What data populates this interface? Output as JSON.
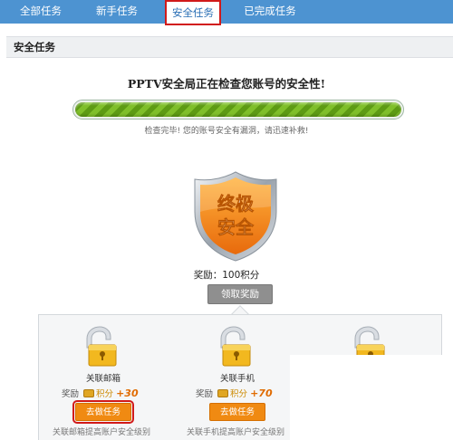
{
  "tabs": [
    {
      "label": "全部任务"
    },
    {
      "label": "新手任务"
    },
    {
      "label": "安全任务"
    },
    {
      "label": "已完成任务"
    }
  ],
  "section": {
    "title": "安全任务"
  },
  "scan": {
    "title": "PPTV安全局正在检查您账号的安全性!",
    "progress_percent": 100,
    "result": "检查完毕! 您的账号安全有漏洞，请迅速补救!"
  },
  "badge": {
    "line1": "终极",
    "line2": "安全"
  },
  "reward": {
    "text": "奖励：100积分",
    "claim_label": "领取奖励"
  },
  "tasks": [
    {
      "name": "关联邮箱",
      "reward_label": "奖励",
      "points_label": "积分",
      "points": "+30",
      "button": "去做任务",
      "desc": "关联邮箱提高账户安全级别"
    },
    {
      "name": "关联手机",
      "reward_label": "奖励",
      "points_label": "积分",
      "points": "+70",
      "button": "去做任务",
      "desc": "关联手机提高账户安全级别"
    }
  ],
  "colors": {
    "tab_bar": "#4d93d1",
    "highlight": "#d11a1a",
    "button_orange": "#f08a12",
    "shield_orange": "#f28a1b",
    "progress_green": "#7fbf2a"
  },
  "icons": [
    "lock-icon",
    "coin-icon",
    "shield-icon"
  ]
}
